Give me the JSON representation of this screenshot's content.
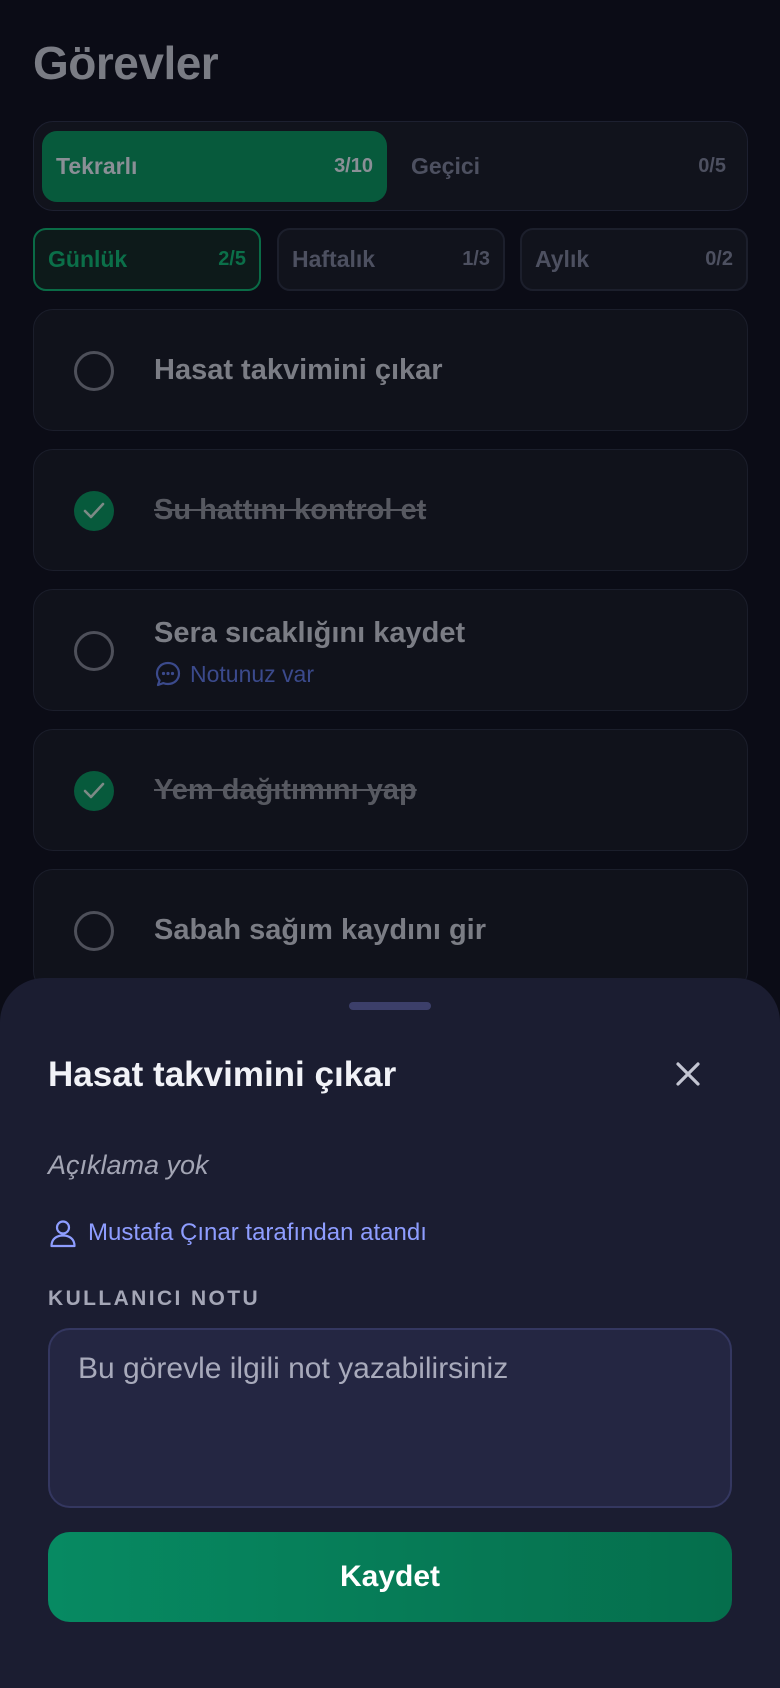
{
  "page": {
    "title": "Görevler"
  },
  "segments": [
    {
      "label": "Tekrarlı",
      "count": "3/10",
      "active": true
    },
    {
      "label": "Geçici",
      "count": "0/5",
      "active": false
    }
  ],
  "periods": [
    {
      "label": "Günlük",
      "count": "2/5",
      "active": true
    },
    {
      "label": "Haftalık",
      "count": "1/3",
      "active": false
    },
    {
      "label": "Aylık",
      "count": "0/2",
      "active": false
    }
  ],
  "tasks": [
    {
      "title": "Hasat takvimini çıkar",
      "done": false
    },
    {
      "title": "Su hattını kontrol et",
      "done": true
    },
    {
      "title": "Sera sıcaklığını kaydet",
      "done": false,
      "note": "Notunuz var"
    },
    {
      "title": "Yem dağıtımını yap",
      "done": true
    },
    {
      "title": "Sabah sağım kaydını gir",
      "done": false
    }
  ],
  "sheet": {
    "title": "Hasat takvimini çıkar",
    "description": "Açıklama yok",
    "assigned_by": "Mustafa Çınar tarafından atandı",
    "note_section_label": "KULLANICI NOTU",
    "note_placeholder": "Bu görevle ilgili not yazabilirsiniz",
    "note_value": "",
    "save_label": "Kaydet"
  },
  "colors": {
    "accent": "#078a62",
    "link": "#8e9dff",
    "background": "#0b0c16",
    "sheet": "#1b1d31"
  },
  "icons": {
    "check": "check-icon",
    "close": "close-icon",
    "user": "user-icon",
    "comment": "comment-icon"
  }
}
